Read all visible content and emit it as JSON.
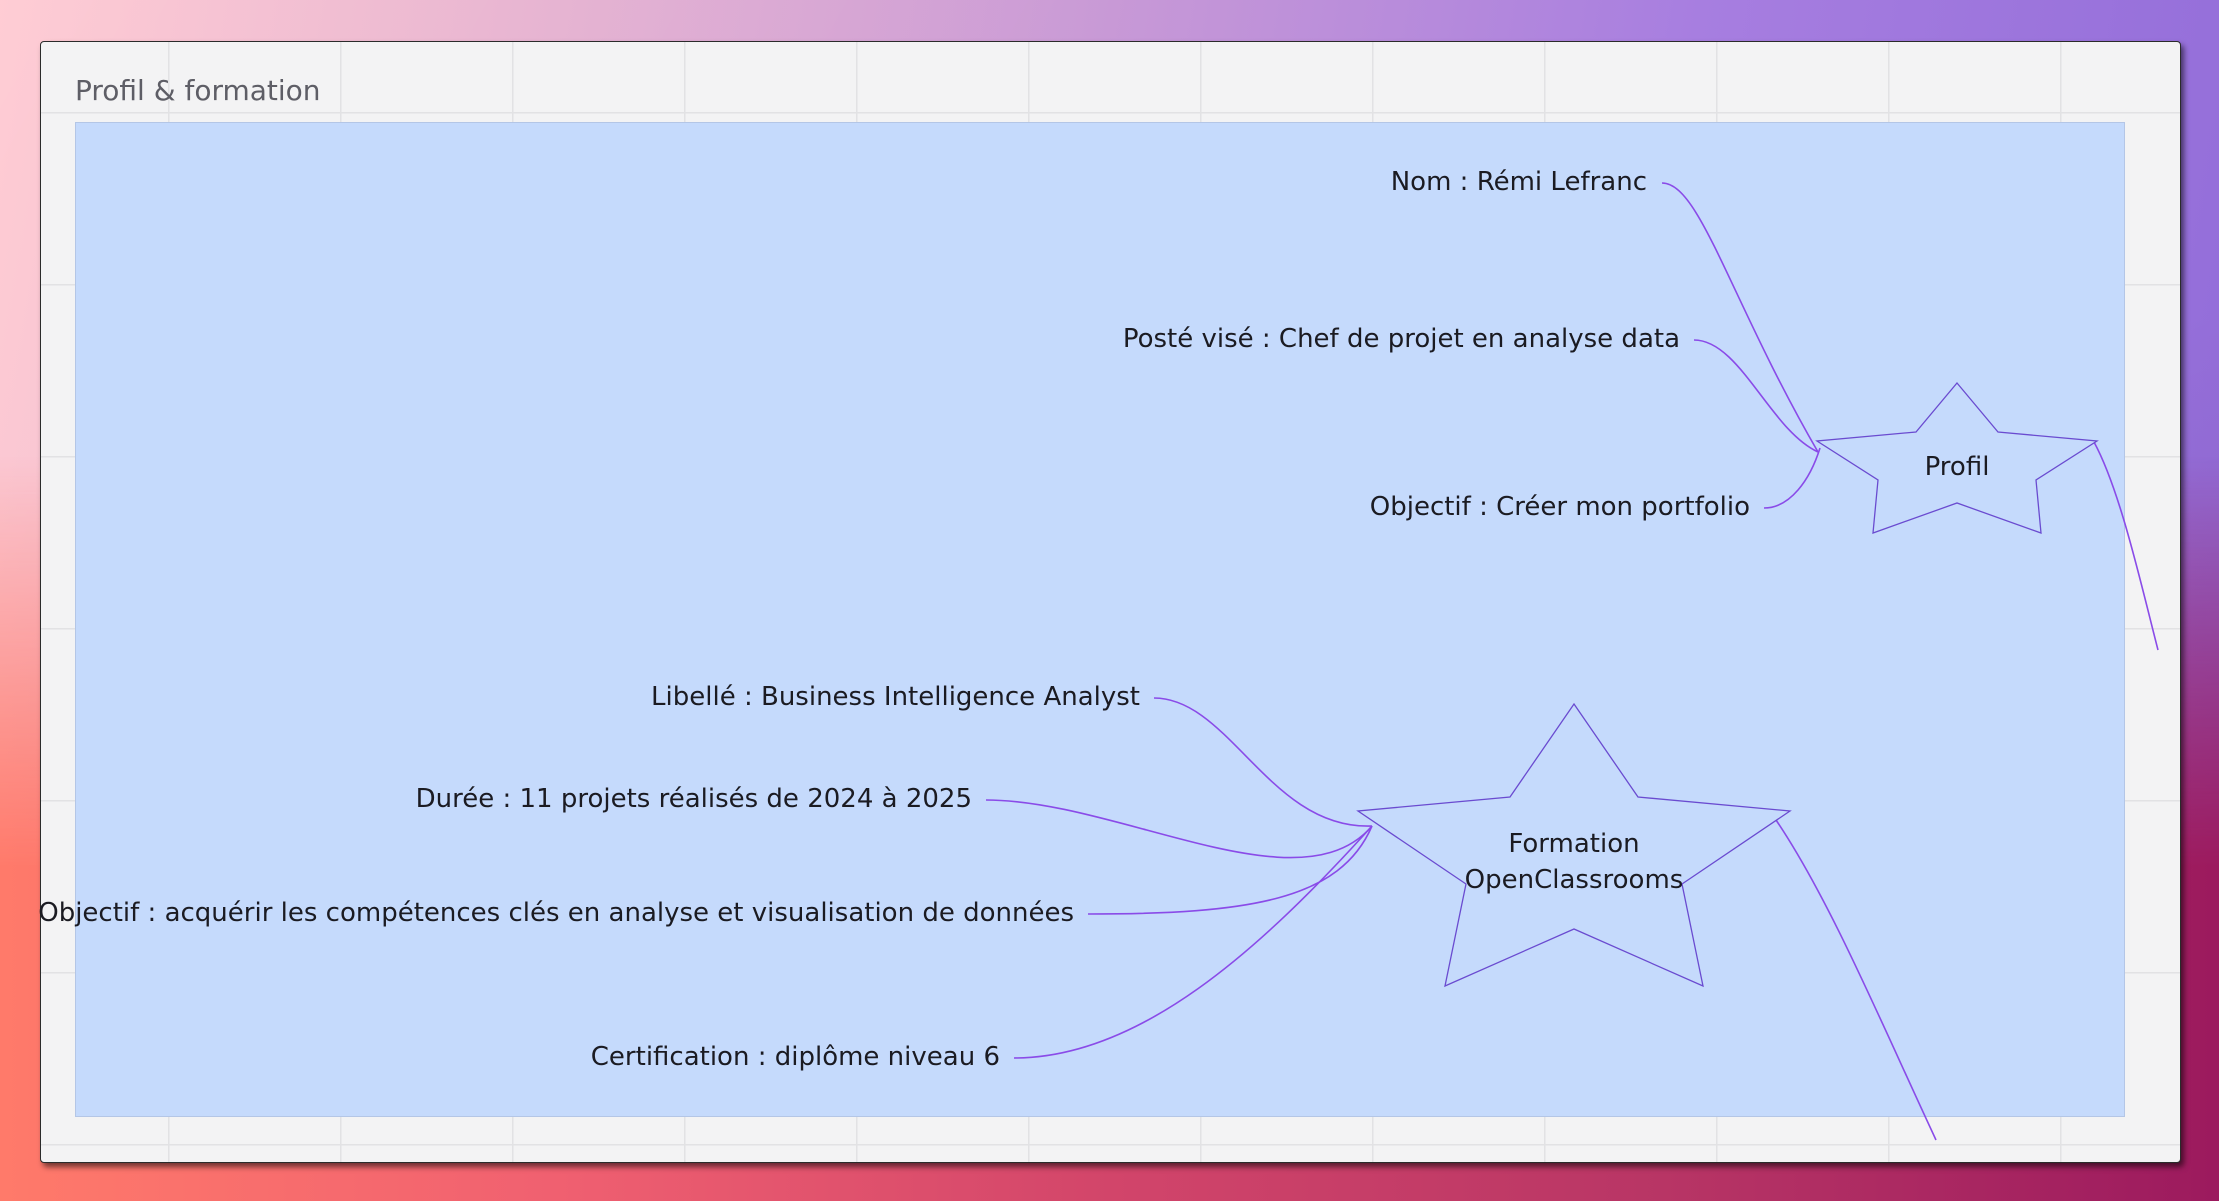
{
  "frame": {
    "title": "Profil & formation"
  },
  "nodes": {
    "profil": {
      "label": "Profil",
      "items": [
        "Nom : Rémi Lefranc",
        "Posté visé : Chef de projet en analyse data",
        "Objectif : Créer mon portfolio"
      ]
    },
    "formation": {
      "label_line1": "Formation",
      "label_line2": "OpenClassrooms",
      "items": [
        "Libellé : Business Intelligence Analyst",
        "Durée : 11 projets réalisés de 2024 à 2025",
        "Objectif : acquérir les compétences clés en analyse et visualisation de données",
        "Certification : diplôme niveau 6"
      ]
    }
  },
  "colors": {
    "frame_fill": "#c5dafc",
    "connector": "#8a4be8",
    "star_stroke": "#6a4bd0"
  }
}
